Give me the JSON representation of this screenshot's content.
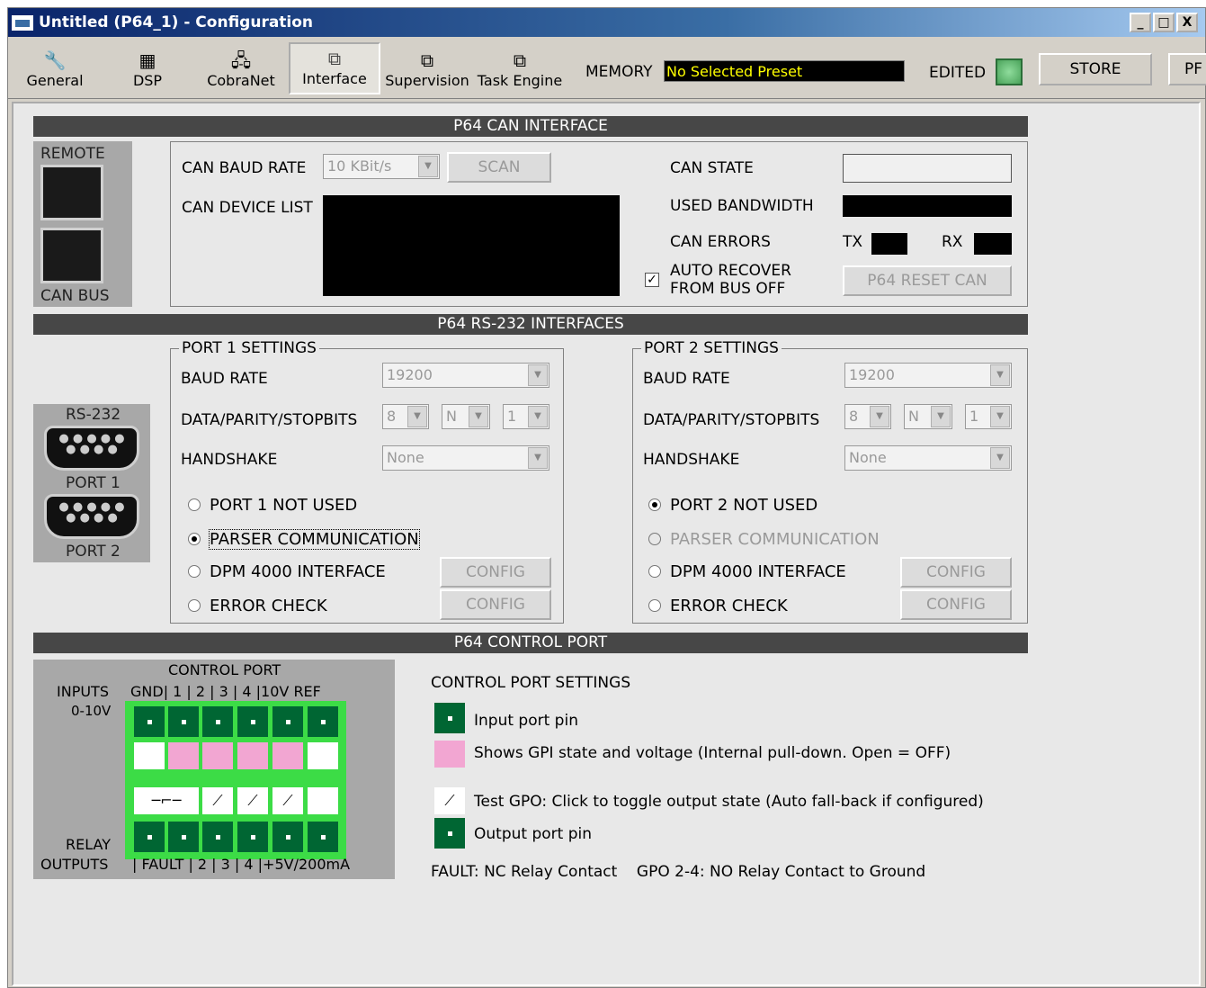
{
  "window": {
    "title": "Untitled (P64_1) - Configuration",
    "controls": [
      "_",
      "□",
      "X"
    ]
  },
  "toolbar": {
    "tabs": [
      {
        "label": "General",
        "icon": "wrench-icon"
      },
      {
        "label": "DSP",
        "icon": "dsp-icon"
      },
      {
        "label": "CobraNet",
        "icon": "network-icon"
      },
      {
        "label": "Interface",
        "icon": "interface-icon"
      },
      {
        "label": "Supervision",
        "icon": "supervision-icon"
      },
      {
        "label": "Task Engine",
        "icon": "task-icon"
      }
    ],
    "active_tab": "Interface",
    "memory_label": "MEMORY",
    "memory_value": "No Selected Preset",
    "edited_label": "EDITED",
    "store_label": "STORE",
    "pf_label": "PF"
  },
  "can": {
    "header": "P64 CAN INTERFACE",
    "remote_label": "REMOTE",
    "canbus_label": "CAN BUS",
    "baud_label": "CAN BAUD RATE",
    "baud_value": "10 KBit/s",
    "scan_label": "SCAN",
    "device_list_label": "CAN DEVICE LIST",
    "state_label": "CAN STATE",
    "bandwidth_label": "USED BANDWIDTH",
    "errors_label": "CAN ERRORS",
    "tx_label": "TX",
    "rx_label": "RX",
    "auto_recover_line1": "AUTO RECOVER",
    "auto_recover_line2": "FROM BUS OFF",
    "auto_recover_checked": true,
    "reset_label": "P64 RESET CAN"
  },
  "rs232": {
    "header": "P64 RS-232 INTERFACES",
    "connector_label": "RS-232",
    "port1_label": "PORT 1",
    "port2_label": "PORT 2",
    "ports": [
      {
        "title": "PORT 1 SETTINGS",
        "baud_label": "BAUD RATE",
        "baud_value": "19200",
        "dps_label": "DATA/PARITY/STOPBITS",
        "data_value": "8",
        "parity_value": "N",
        "stop_value": "1",
        "handshake_label": "HANDSHAKE",
        "handshake_value": "None",
        "options": [
          "PORT 1 NOT USED",
          "PARSER COMMUNICATION",
          "DPM 4000 INTERFACE",
          "ERROR CHECK"
        ],
        "selected": "PARSER COMMUNICATION",
        "config_label": "CONFIG"
      },
      {
        "title": "PORT 2 SETTINGS",
        "baud_label": "BAUD RATE",
        "baud_value": "19200",
        "dps_label": "DATA/PARITY/STOPBITS",
        "data_value": "8",
        "parity_value": "N",
        "stop_value": "1",
        "handshake_label": "HANDSHAKE",
        "handshake_value": "None",
        "options": [
          "PORT 2 NOT USED",
          "PARSER COMMUNICATION",
          "DPM 4000 INTERFACE",
          "ERROR CHECK"
        ],
        "selected": "PORT 2 NOT USED",
        "config_label": "CONFIG"
      }
    ]
  },
  "control": {
    "header": "P64 CONTROL PORT",
    "panel_title": "CONTROL PORT",
    "inputs_label": "INPUTS",
    "range_label": "0-10V",
    "top_pins": "GND|  1  |  2  |  3  |  4  |10V REF",
    "relay_label": "RELAY",
    "outputs_label": "OUTPUTS",
    "bottom_pins": "|  FAULT  |  2  |  3  |  4  |+5V/200mA",
    "settings_title": "CONTROL PORT SETTINGS",
    "legend": [
      "Input port pin",
      "Shows GPI state and voltage (Internal pull-down. Open = OFF)",
      "Test GPO: Click to toggle output state (Auto fall-back if configured)",
      "Output port pin"
    ],
    "footnote": "FAULT: NC Relay Contact    GPO 2-4: NO Relay Contact to Ground"
  },
  "colors": {
    "pin": "#006633",
    "terminal": "#3cdc46",
    "gpi": "#f2a6d2",
    "bar": "#474747",
    "memory_text": "#ffff00"
  }
}
